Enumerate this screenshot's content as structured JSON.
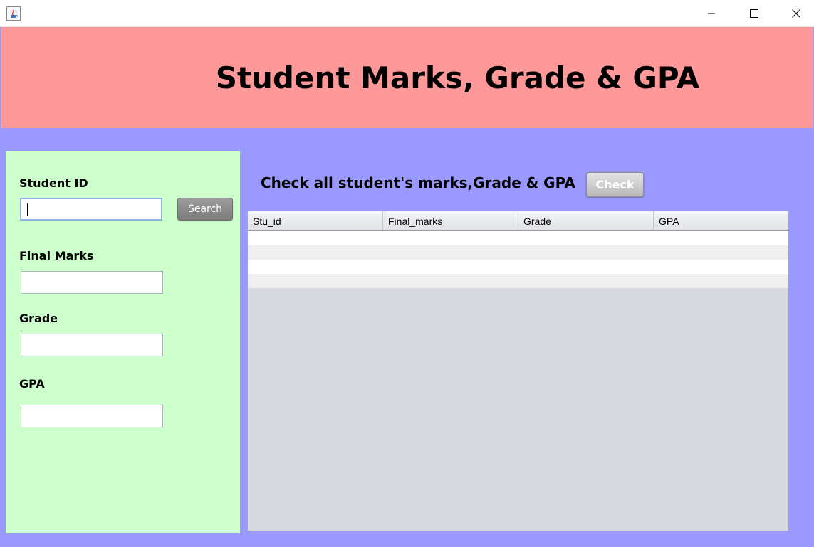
{
  "window": {
    "controls": {
      "minimize": "minimize-icon",
      "maximize": "maximize-icon",
      "close": "close-icon"
    }
  },
  "header": {
    "title": "Student Marks, Grade & GPA"
  },
  "form": {
    "student_id_label": "Student ID",
    "student_id_value": "",
    "search_label": "Search",
    "final_marks_label": "Final Marks",
    "final_marks_value": "",
    "grade_label": "Grade",
    "grade_value": "",
    "gpa_label": "GPA",
    "gpa_value": ""
  },
  "check": {
    "label": "Check all student's marks,Grade & GPA",
    "button": "Check"
  },
  "table": {
    "columns": [
      "Stu_id",
      "Final_marks",
      "Grade",
      "GPA"
    ],
    "rows": [
      [
        "",
        "",
        "",
        ""
      ],
      [
        "",
        "",
        "",
        ""
      ],
      [
        "",
        "",
        "",
        ""
      ],
      [
        "",
        "",
        "",
        ""
      ]
    ]
  },
  "colors": {
    "header_bg": "#ff9999",
    "body_bg": "#9a99ff",
    "panel_bg": "#ccffcc",
    "table_empty_bg": "#d6d9e0"
  }
}
